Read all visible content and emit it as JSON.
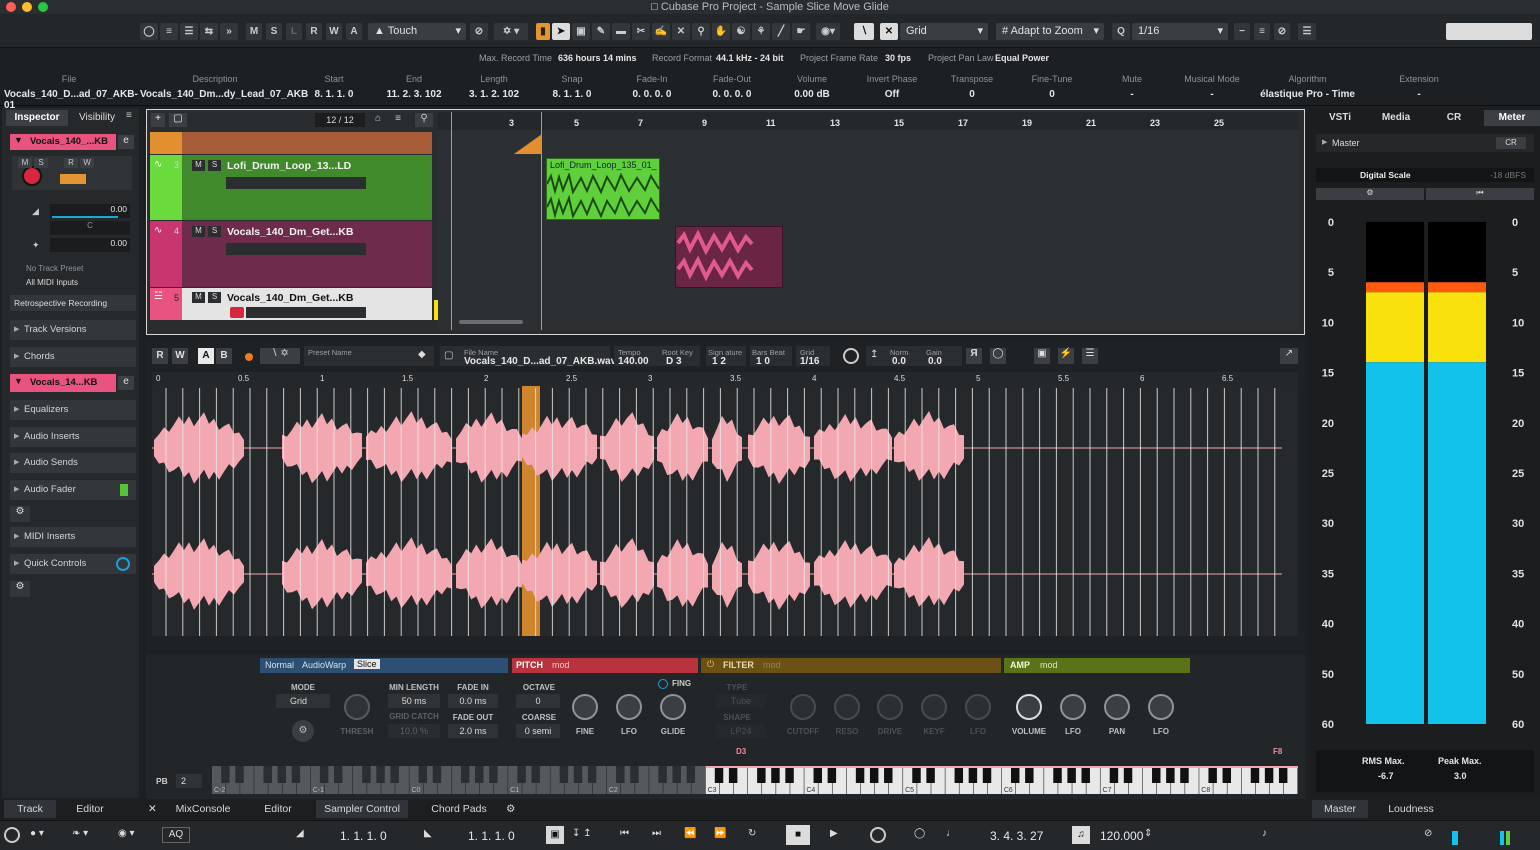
{
  "window": {
    "title": "Cubase Pro Project - Sample Slice Move Glide"
  },
  "toolbar": {
    "m": "M",
    "s": "S",
    "l": "L",
    "r": "R",
    "w": "W",
    "a": "A",
    "automation_mode": "Touch",
    "grid_type": "Grid",
    "zoom_mode": "Adapt to Zoom",
    "quantize": "1/16"
  },
  "status": [
    {
      "label": "Max. Record Time",
      "value": "636 hours 14 mins"
    },
    {
      "label": "Record Format",
      "value": "44.1 kHz - 24 bit"
    },
    {
      "label": "Project Frame Rate",
      "value": "30 fps"
    },
    {
      "label": "Project Pan Law",
      "value": "Equal Power"
    }
  ],
  "infoline": [
    {
      "h": "File",
      "v": "Vocals_140_D...ad_07_AKB-01"
    },
    {
      "h": "Description",
      "v": "Vocals_140_Dm...dy_Lead_07_AKB"
    },
    {
      "h": "Start",
      "v": "8. 1. 1.   0"
    },
    {
      "h": "End",
      "v": "11. 2. 3. 102"
    },
    {
      "h": "Length",
      "v": "3. 1. 2. 102"
    },
    {
      "h": "Snap",
      "v": "8. 1. 1.   0"
    },
    {
      "h": "Fade-In",
      "v": "0. 0. 0.   0"
    },
    {
      "h": "Fade-Out",
      "v": "0. 0. 0.   0"
    },
    {
      "h": "Volume",
      "v": "0.00          dB"
    },
    {
      "h": "Invert Phase",
      "v": "Off"
    },
    {
      "h": "Transpose",
      "v": "0"
    },
    {
      "h": "Fine-Tune",
      "v": "0"
    },
    {
      "h": "Mute",
      "v": "-"
    },
    {
      "h": "Musical Mode",
      "v": "-"
    },
    {
      "h": "Algorithm",
      "v": "élastique Pro - Time"
    },
    {
      "h": "Extension",
      "v": "-"
    }
  ],
  "inspector": {
    "tabs": [
      "Inspector",
      "Visibility"
    ],
    "track_name": "Vocals_140_...KB",
    "volume": "0.00",
    "pan": "C",
    "send": "0.00",
    "no_preset": "No Track Preset",
    "midi_inputs": "All MIDI Inputs",
    "retro": "Retrospective Recording",
    "sections": [
      "Track Versions",
      "Chords"
    ],
    "track2_name": "Vocals_14...KB",
    "sections2": [
      "Equalizers",
      "Audio Inserts",
      "Audio Sends",
      "Audio Fader"
    ],
    "sections3": [
      "MIDI Inserts",
      "Quick Controls"
    ]
  },
  "project": {
    "track_count": "12 / 12",
    "ruler": [
      "3",
      "5",
      "7",
      "9",
      "11",
      "13",
      "15",
      "17",
      "19",
      "21",
      "23",
      "25"
    ],
    "tracks": [
      {
        "num": "3",
        "name": "Lofi_Drum_Loop_13...LD"
      },
      {
        "num": "4",
        "name": "Vocals_140_Dm_Get...KB"
      },
      {
        "num": "5",
        "name": "Vocals_140_Dm_Get...KB"
      }
    ],
    "event_label": "Lofi_Drum_Loop_135_01_"
  },
  "editor": {
    "r": "R",
    "w": "W",
    "a": "A",
    "b": "B",
    "preset_label": "Preset Name",
    "file_label": "File Name",
    "file_name": "Vocals_140_D...ad_07_AKB.wav",
    "tempo_label": "Tempo",
    "tempo": "140.00",
    "root_label": "Root Key",
    "root": "D 3",
    "sig_label": "Sign ature",
    "sig": "1   2",
    "bars_label": "Bars Beat",
    "bars": "1   0",
    "grid_label": "Grid",
    "grid": "1/16",
    "norm_label": "Norm",
    "norm": "0.0",
    "gain_label": "Gain",
    "gain": "0.0",
    "ruler": [
      "0",
      "0.5",
      "1",
      "1.5",
      "2",
      "2.5",
      "3",
      "3.5",
      "4",
      "4.5",
      "5",
      "5.5",
      "6",
      "6.5"
    ]
  },
  "sampler": {
    "modes": [
      "Normal",
      "AudioWarp",
      "Slice"
    ],
    "mode_label": "MODE",
    "mode_value": "Grid",
    "thresh": "THRESH",
    "min_len_label": "MIN LENGTH",
    "min_len": "50 ms",
    "grid_catch": "GRID CATCH",
    "grid_catch_val": "10.0 %",
    "fade_in_label": "FADE IN",
    "fade_in": "0.0 ms",
    "fade_out_label": "FADE OUT",
    "fade_out": "2.0 ms",
    "pitch_label": "PITCH",
    "pitch_mod": "mod",
    "octave_label": "OCTAVE",
    "octave": "0",
    "coarse_label": "COARSE",
    "coarse": "0 semi",
    "fine": "FINE",
    "lfo": "LFO",
    "glide": "GLIDE",
    "fing": "FING",
    "filter_label": "FILTER",
    "filter_mod": "mod",
    "type_label": "TYPE",
    "type_val": "Tube",
    "shape_label": "SHAPE",
    "shape_val": "LP24",
    "cutoff": "CUTOFF",
    "reso": "RESO",
    "drive": "DRIVE",
    "keyf": "KEYF",
    "flfo": "LFO",
    "amp_label": "AMP",
    "amp_mod": "mod",
    "volume": "VOLUME",
    "alfo": "LFO",
    "pan": "PAN",
    "alfo2": "LFO",
    "pb_label": "PB",
    "pb": "2",
    "key_low": "D3",
    "key_high": "F8",
    "octaves": [
      "C-2",
      "C-1",
      "C0",
      "C1",
      "C2",
      "C3",
      "C4",
      "C5",
      "C6",
      "C7",
      "C8"
    ]
  },
  "meter": {
    "tabs": [
      "VSTi",
      "Media",
      "CR",
      "Meter"
    ],
    "master": "Master",
    "cr": "CR",
    "scale": "Digital Scale",
    "scale_val": "-18 dBFS",
    "ticks": [
      "0",
      "5",
      "10",
      "15",
      "20",
      "25",
      "30",
      "35",
      "40",
      "50",
      "60"
    ],
    "rms_label": "RMS Max.",
    "rms": "-6.7",
    "peak_label": "Peak Max.",
    "peak": "3.0",
    "level_fraction": 0.88,
    "bottom_tabs": [
      "Master",
      "Loudness"
    ]
  },
  "bottom_tabs": [
    "Track",
    "Editor",
    "MixConsole",
    "Editor",
    "Sampler Control",
    "Chord Pads"
  ],
  "transport": {
    "left_locator": "1. 1. 1.   0",
    "right_locator": "1. 1. 1.   0",
    "position": "3. 4. 3. 27",
    "tempo": "120.000",
    "aq": "AQ"
  },
  "colors": {
    "green": "#5fcf3c",
    "pink": "#f3a7b1",
    "vocal": "#e05a8e",
    "orange": "#e18f2f",
    "meter_cyan": "#13c2ea",
    "meter_yellow": "#f9e10e",
    "meter_orange": "#ff5a10"
  }
}
